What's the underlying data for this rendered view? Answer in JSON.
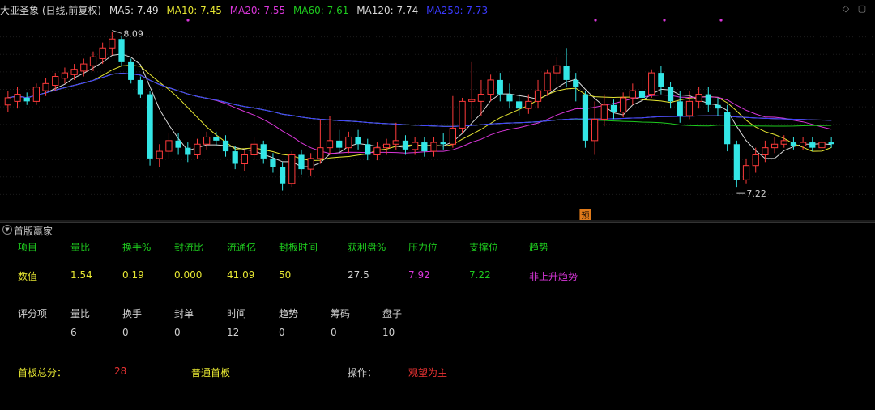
{
  "header": {
    "title": "大亚圣象 (日线,前复权)",
    "ma5": "MA5: 7.49",
    "ma10": "MA10: 7.45",
    "ma20": "MA20: 7.55",
    "ma60": "MA60: 7.61",
    "ma120": "MA120: 7.74",
    "ma250": "MA250: 7.73"
  },
  "colors": {
    "up": "#ff3b3b",
    "down": "#33e6e6",
    "ma5": "#d8d8d8",
    "ma10": "#e6e632",
    "ma20": "#d936d9",
    "ma60": "#1eca1e",
    "ma120": "#d8d8d8",
    "ma250": "#3a3aff"
  },
  "chart_data": {
    "type": "candlestick",
    "title": "大亚圣象 (日线,前复权)",
    "ylim": [
      7.08,
      8.16
    ],
    "annotations": [
      {
        "label": "8.09",
        "index": 11,
        "value": 8.09,
        "kind": "high"
      },
      {
        "label": "7.22",
        "index": 77,
        "value": 7.22,
        "kind": "low"
      }
    ],
    "marker": {
      "label": "预",
      "index": 61
    },
    "candles": [
      [
        7.68,
        7.72,
        7.64,
        7.76
      ],
      [
        7.7,
        7.74,
        7.66,
        7.78
      ],
      [
        7.72,
        7.7,
        7.68,
        7.75
      ],
      [
        7.7,
        7.78,
        7.68,
        7.8
      ],
      [
        7.76,
        7.8,
        7.73,
        7.83
      ],
      [
        7.79,
        7.84,
        7.76,
        7.86
      ],
      [
        7.83,
        7.86,
        7.8,
        7.89
      ],
      [
        7.85,
        7.88,
        7.82,
        7.91
      ],
      [
        7.87,
        7.91,
        7.84,
        7.94
      ],
      [
        7.9,
        7.95,
        7.87,
        7.98
      ],
      [
        7.94,
        8.0,
        7.91,
        8.03
      ],
      [
        8.0,
        8.05,
        7.96,
        8.09
      ],
      [
        8.05,
        7.92,
        7.9,
        8.07
      ],
      [
        7.92,
        7.82,
        7.8,
        7.94
      ],
      [
        7.82,
        7.74,
        7.72,
        7.84
      ],
      [
        7.74,
        7.38,
        7.34,
        7.76
      ],
      [
        7.38,
        7.42,
        7.33,
        7.46
      ],
      [
        7.42,
        7.48,
        7.38,
        7.52
      ],
      [
        7.48,
        7.44,
        7.4,
        7.52
      ],
      [
        7.44,
        7.4,
        7.36,
        7.47
      ],
      [
        7.4,
        7.46,
        7.38,
        7.49
      ],
      [
        7.46,
        7.5,
        7.43,
        7.53
      ],
      [
        7.5,
        7.48,
        7.45,
        7.53
      ],
      [
        7.48,
        7.42,
        7.39,
        7.51
      ],
      [
        7.42,
        7.35,
        7.32,
        7.45
      ],
      [
        7.35,
        7.4,
        7.31,
        7.43
      ],
      [
        7.4,
        7.46,
        7.37,
        7.5
      ],
      [
        7.46,
        7.38,
        7.35,
        7.48
      ],
      [
        7.38,
        7.33,
        7.3,
        7.41
      ],
      [
        7.33,
        7.24,
        7.2,
        7.36
      ],
      [
        7.24,
        7.4,
        7.22,
        7.42
      ],
      [
        7.4,
        7.32,
        7.29,
        7.43
      ],
      [
        7.32,
        7.38,
        7.28,
        7.41
      ],
      [
        7.38,
        7.44,
        7.35,
        7.6
      ],
      [
        7.44,
        7.48,
        7.4,
        7.62
      ],
      [
        7.48,
        7.44,
        7.41,
        7.54
      ],
      [
        7.44,
        7.5,
        7.41,
        7.53
      ],
      [
        7.5,
        7.46,
        7.43,
        7.54
      ],
      [
        7.46,
        7.4,
        7.37,
        7.49
      ],
      [
        7.4,
        7.44,
        7.37,
        7.47
      ],
      [
        7.44,
        7.46,
        7.4,
        7.49
      ],
      [
        7.46,
        7.48,
        7.43,
        7.58
      ],
      [
        7.48,
        7.43,
        7.4,
        7.51
      ],
      [
        7.43,
        7.47,
        7.4,
        7.5
      ],
      [
        7.47,
        7.42,
        7.39,
        7.5
      ],
      [
        7.42,
        7.47,
        7.39,
        7.5
      ],
      [
        7.47,
        7.46,
        7.43,
        7.52
      ],
      [
        7.46,
        7.55,
        7.44,
        7.73
      ],
      [
        7.55,
        7.7,
        7.52,
        7.72
      ],
      [
        7.7,
        7.71,
        7.6,
        7.92
      ],
      [
        7.7,
        7.74,
        7.62,
        7.82
      ],
      [
        7.74,
        7.82,
        7.7,
        7.85
      ],
      [
        7.82,
        7.74,
        7.7,
        7.86
      ],
      [
        7.74,
        7.7,
        7.66,
        7.8
      ],
      [
        7.7,
        7.66,
        7.62,
        7.74
      ],
      [
        7.66,
        7.7,
        7.63,
        7.74
      ],
      [
        7.7,
        7.76,
        7.66,
        7.82
      ],
      [
        7.76,
        7.86,
        7.73,
        7.88
      ],
      [
        7.86,
        7.9,
        7.8,
        7.95
      ],
      [
        7.9,
        7.82,
        7.78,
        8.0
      ],
      [
        7.82,
        7.78,
        7.7,
        7.86
      ],
      [
        7.74,
        7.48,
        7.44,
        7.76
      ],
      [
        7.48,
        7.6,
        7.4,
        7.7
      ],
      [
        7.6,
        7.68,
        7.56,
        7.74
      ],
      [
        7.68,
        7.64,
        7.6,
        7.71
      ],
      [
        7.64,
        7.72,
        7.61,
        7.75
      ],
      [
        7.72,
        7.76,
        7.68,
        7.8
      ],
      [
        7.76,
        7.72,
        7.7,
        7.84
      ],
      [
        7.74,
        7.86,
        7.72,
        7.88
      ],
      [
        7.86,
        7.78,
        7.74,
        7.9
      ],
      [
        7.78,
        7.7,
        7.66,
        7.81
      ],
      [
        7.7,
        7.62,
        7.58,
        7.76
      ],
      [
        7.62,
        7.7,
        7.6,
        7.76
      ],
      [
        7.7,
        7.74,
        7.66,
        7.78
      ],
      [
        7.74,
        7.68,
        7.64,
        7.78
      ],
      [
        7.68,
        7.66,
        7.62,
        7.72
      ],
      [
        7.64,
        7.46,
        7.42,
        7.68
      ],
      [
        7.46,
        7.26,
        7.22,
        7.48
      ],
      [
        7.26,
        7.34,
        7.24,
        7.38
      ],
      [
        7.34,
        7.4,
        7.3,
        7.44
      ],
      [
        7.4,
        7.44,
        7.36,
        7.48
      ],
      [
        7.44,
        7.46,
        7.41,
        7.5
      ],
      [
        7.46,
        7.48,
        7.44,
        7.51
      ],
      [
        7.47,
        7.45,
        7.43,
        7.5
      ],
      [
        7.45,
        7.47,
        7.43,
        7.5
      ],
      [
        7.47,
        7.44,
        7.42,
        7.5
      ],
      [
        7.44,
        7.47,
        7.42,
        7.49
      ],
      [
        7.47,
        7.46,
        7.44,
        7.5
      ]
    ]
  },
  "panel": {
    "title": "首版赢家",
    "row1": {
      "label": "项目",
      "headers": [
        "量比",
        "换手%",
        "封流比",
        "流通亿",
        "封板时间",
        "获利盘%",
        "压力位",
        "支撑位",
        "趋势"
      ]
    },
    "row2": {
      "label": "数值",
      "values": [
        "1.54",
        "0.19",
        "0.000",
        "41.09",
        "50",
        "27.5",
        "7.92",
        "7.22",
        "非上升趋势"
      ]
    },
    "score_row": {
      "label": "评分项",
      "headers": [
        "量比",
        "换手",
        "封单",
        "时间",
        "趋势",
        "筹码",
        "盘子"
      ],
      "values": [
        "6",
        "0",
        "0",
        "12",
        "0",
        "0",
        "10"
      ]
    },
    "summary": {
      "total_label": "首板总分：",
      "total_value": "28",
      "type_value": "普通首板",
      "op_label": "操作：",
      "op_value": "观望为主"
    }
  }
}
